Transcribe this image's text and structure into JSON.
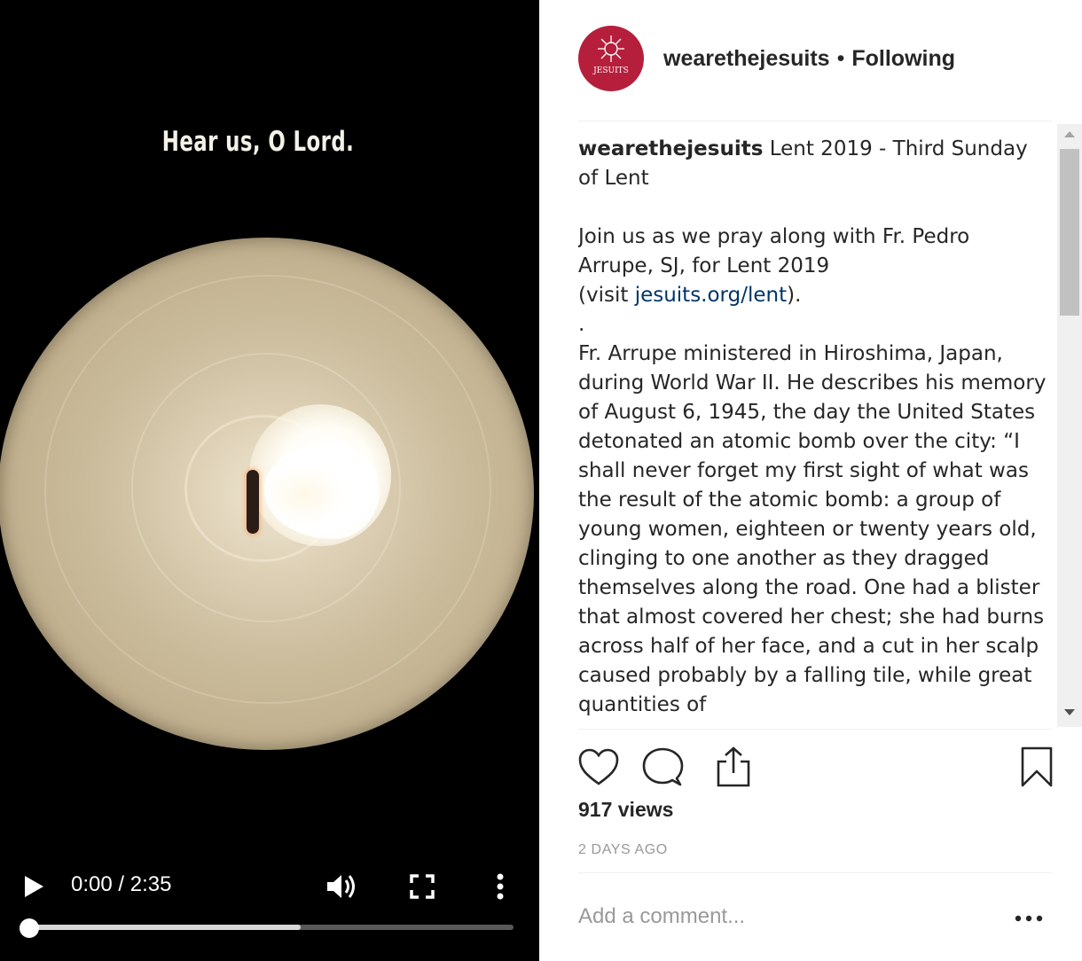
{
  "video": {
    "overlay_caption": "Hear us, O Lord.",
    "time_display": "0:00 / 2:35",
    "progress_fraction": 0.56
  },
  "post": {
    "avatar_text": "JESUITS",
    "username": "wearethejesuits",
    "separator": "•",
    "follow_status": "Following",
    "caption": {
      "author": "wearethejesuits",
      "title": " Lent 2019 - Third Sunday of Lent",
      "para1": "Join us as we pray along with Fr. Pedro Arrupe, SJ, for Lent 2019",
      "visit_prefix": "(visit ",
      "link": "jesuits.org/lent",
      "visit_suffix": ").",
      "dot": ".",
      "para2": "Fr. Arrupe ministered in Hiroshima, Japan, during World War II. He describes his memory of August 6, 1945, the day the United States detonated an atomic bomb over the city: “I shall never forget my first sight of what was the result of the atomic bomb: a group of young women, eighteen or twenty years old, clinging to one another as they dragged themselves along the road. One had a blister that almost covered her chest; she had burns across half of her face, and a cut in her scalp caused probably by a falling tile, while great quantities of"
    },
    "views": "917 views",
    "date": "2 DAYS AGO",
    "add_comment_placeholder": "Add a comment...",
    "more_label": "•••"
  },
  "colors": {
    "brand": "#b51f3b",
    "link": "#003569",
    "muted": "#999999"
  }
}
